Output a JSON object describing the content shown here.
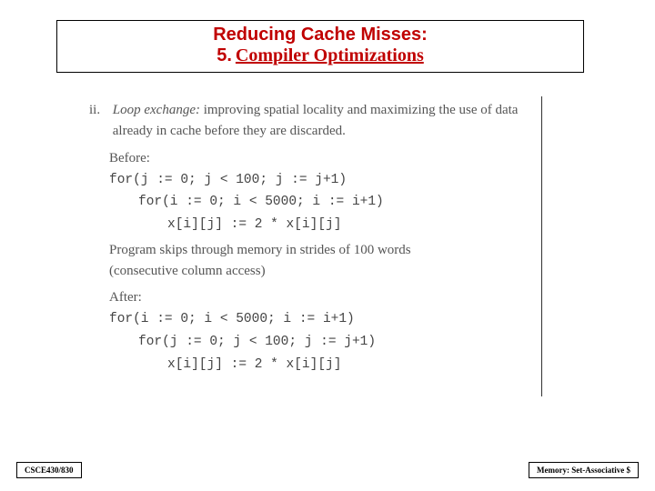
{
  "title": {
    "line1": "Reducing Cache Misses:",
    "num": "5.",
    "underline": "Compiler Optimizations"
  },
  "body": {
    "marker": "ii.",
    "loopex_label": "Loop exchange:",
    "loopex_rest": " improving spatial locality and maximizing the use of data already in cache before they are discarded.",
    "before": "Before:",
    "code1a": "for(j := 0; j < 100; j := j+1)",
    "code1b": "for(i := 0; i < 5000; i := i+1)",
    "code1c": "x[i][j] := 2 * x[i][j]",
    "skip1": "Program skips through memory in strides of 100 words",
    "skip2": "(consecutive column access)",
    "after": "After:",
    "code2a": "for(i := 0; i < 5000; i := i+1)",
    "code2b": "for(j := 0; j < 100; j := j+1)",
    "code2c": "x[i][j] := 2 * x[i][j]"
  },
  "footer": {
    "left": "CSCE430/830",
    "right": "Memory: Set-Associative $"
  }
}
